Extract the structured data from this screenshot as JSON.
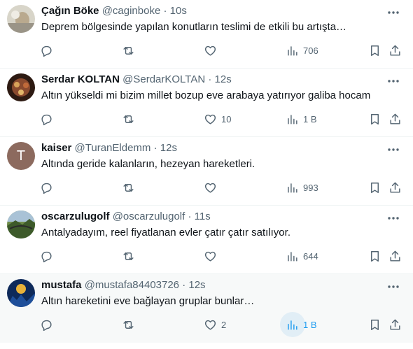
{
  "tweets": [
    {
      "name": "Çağın Böke",
      "handle": "@caginboke",
      "time": "10s",
      "text": "Deprem bölgesinde yapılan konutların teslimi de etkili bu artışta…",
      "replies": "",
      "retweets": "",
      "likes": "",
      "views": "706",
      "avatar_color": "#c9c6b8"
    },
    {
      "name": "Serdar KOLTAN",
      "handle": "@SerdarKOLTAN",
      "time": "12s",
      "text": "Altın yükseldi mi bizim millet bozup eve arabaya yatırıyor galiba hocam",
      "replies": "",
      "retweets": "",
      "likes": "10",
      "views": "1 B",
      "avatar_color": "#6b3a2a"
    },
    {
      "name": "kaiser",
      "handle": "@TuranEldemm",
      "time": "12s",
      "text": "Altında geride kalanların, hezeyan hareketleri.",
      "replies": "",
      "retweets": "",
      "likes": "",
      "views": "993",
      "avatar_letter": "T",
      "avatar_color": "#8c6a5e"
    },
    {
      "name": "oscarzulugolf",
      "handle": "@oscarzulugolf",
      "time": "11s",
      "text": "Antalyadayım, reel fiyatlanan evler çatır çatır satılıyor.",
      "replies": "",
      "retweets": "",
      "likes": "",
      "views": "644",
      "avatar_color": "#4f6b3a"
    },
    {
      "name": "mustafa",
      "handle": "@mustafa84403726",
      "time": "12s",
      "text": "Altın hareketini eve bağlayan gruplar bunlar…",
      "replies": "",
      "retweets": "",
      "likes": "2",
      "views": "1 B",
      "avatar_color": "#0e2a5a"
    }
  ],
  "separator": "·",
  "colors": {
    "accent": "#1d9bf0",
    "muted": "#536471",
    "text": "#0f1419",
    "hover_bg": "#f7f9f9"
  },
  "icons": [
    "reply-icon",
    "retweet-icon",
    "like-icon",
    "views-icon",
    "bookmark-icon",
    "share-icon",
    "more-icon"
  ]
}
